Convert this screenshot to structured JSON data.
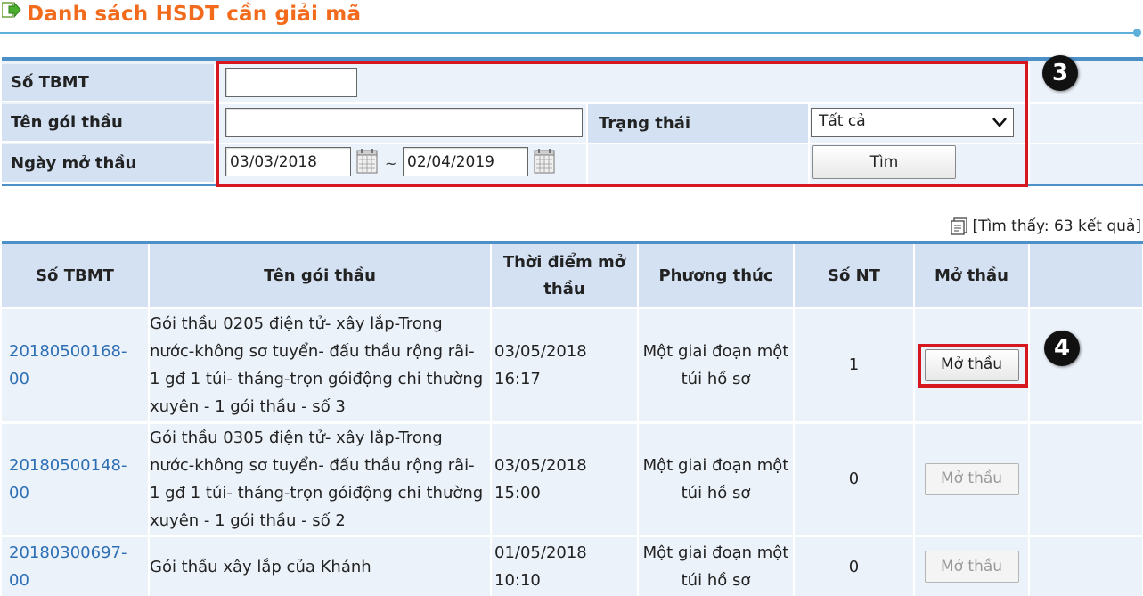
{
  "page": {
    "title": "Danh sách HSDT cần giải mã"
  },
  "search": {
    "so_tbmt_label": "Số TBMT",
    "so_tbmt_value": "",
    "ten_goi_thau_label": "Tên gói thầu",
    "ten_goi_thau_value": "",
    "trang_thai_label": "Trạng thái",
    "trang_thai_selected": "Tất cả",
    "ngay_mo_thau_label": "Ngày mở thầu",
    "date_from": "03/03/2018",
    "date_separator": "~",
    "date_to": "02/04/2019",
    "search_button": "Tìm",
    "badge": "3"
  },
  "results": {
    "found_text": "[Tìm thấy: 63 kết quả]",
    "badge": "4",
    "columns": {
      "so_tbmt": "Số TBMT",
      "ten_goi_thau": "Tên gói thầu",
      "thoi_diem_mo_thau": "Thời điểm mở thầu",
      "phuong_thuc": "Phương thức",
      "so_nt": "Số NT",
      "mo_thau": "Mở thầu"
    },
    "rows": [
      {
        "so_tbmt": "20180500168-00",
        "ten_goi_thau": "Gói thầu 0205 điện tử- xây lắp-Trong nước-không sơ tuyển- đấu thầu rộng rãi- 1 gđ 1 túi- tháng-trọn góiđộng chi thường xuyên - 1 gói thầu - số 3",
        "thoi_diem": "03/05/2018 16:17",
        "phuong_thuc": "Một giai đoạn một túi hồ sơ",
        "so_nt": "1",
        "button": "Mở thầu"
      },
      {
        "so_tbmt": "20180500148-00",
        "ten_goi_thau": "Gói thầu 0305 điện tử- xây lắp-Trong nước-không sơ tuyển- đấu thầu rộng rãi- 1 gđ 1 túi- tháng-trọn góiđộng chi thường xuyên - 1 gói thầu - số 2",
        "thoi_diem": "03/05/2018 15:00",
        "phuong_thuc": "Một giai đoạn một túi hồ sơ",
        "so_nt": "0",
        "button": "Mở thầu"
      },
      {
        "so_tbmt": "20180300697-00",
        "ten_goi_thau": "Gói thầu xây lắp của Khánh",
        "thoi_diem": "01/05/2018 10:10",
        "phuong_thuc": "Một giai đoạn một túi hồ sơ",
        "so_nt": "0",
        "button": "Mở thầu"
      }
    ]
  },
  "colors": {
    "title": "#f26b1d",
    "accent_line": "#5fb1d9",
    "header_bg": "#d3e1f3",
    "row_bg": "#ecf2fa",
    "link": "#2d6fb4",
    "highlight": "#d7171f"
  }
}
